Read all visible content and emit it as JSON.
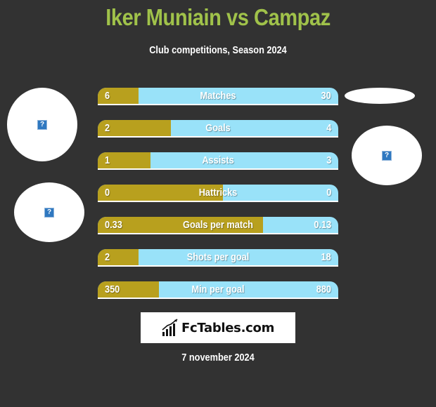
{
  "header": {
    "title": "Iker Muniain vs Campaz",
    "subtitle": "Club competitions, Season 2024"
  },
  "colors": {
    "background": "#323232",
    "title": "#a0c24a",
    "left_player": "#b8a01e",
    "right_player": "#99e2f9"
  },
  "players": {
    "left": {
      "name": "Iker Muniain",
      "image_icon": "broken-image-icon"
    },
    "right": {
      "name": "Campaz",
      "image_icon": "broken-image-icon"
    }
  },
  "stats": [
    {
      "label": "Matches",
      "left": "6",
      "right": "30",
      "left_share": 0.17
    },
    {
      "label": "Goals",
      "left": "2",
      "right": "4",
      "left_share": 0.305
    },
    {
      "label": "Assists",
      "left": "1",
      "right": "3",
      "left_share": 0.22
    },
    {
      "label": "Hattricks",
      "left": "0",
      "right": "0",
      "left_share": 0.52
    },
    {
      "label": "Goals per match",
      "left": "0.33",
      "right": "0.13",
      "left_share": 0.686
    },
    {
      "label": "Shots per goal",
      "left": "2",
      "right": "18",
      "left_share": 0.17
    },
    {
      "label": "Min per goal",
      "left": "350",
      "right": "880",
      "left_share": 0.255
    }
  ],
  "logo": {
    "text": "FcTables.com",
    "icon": "bar-chart-icon"
  },
  "footer": {
    "date": "7 november 2024"
  }
}
